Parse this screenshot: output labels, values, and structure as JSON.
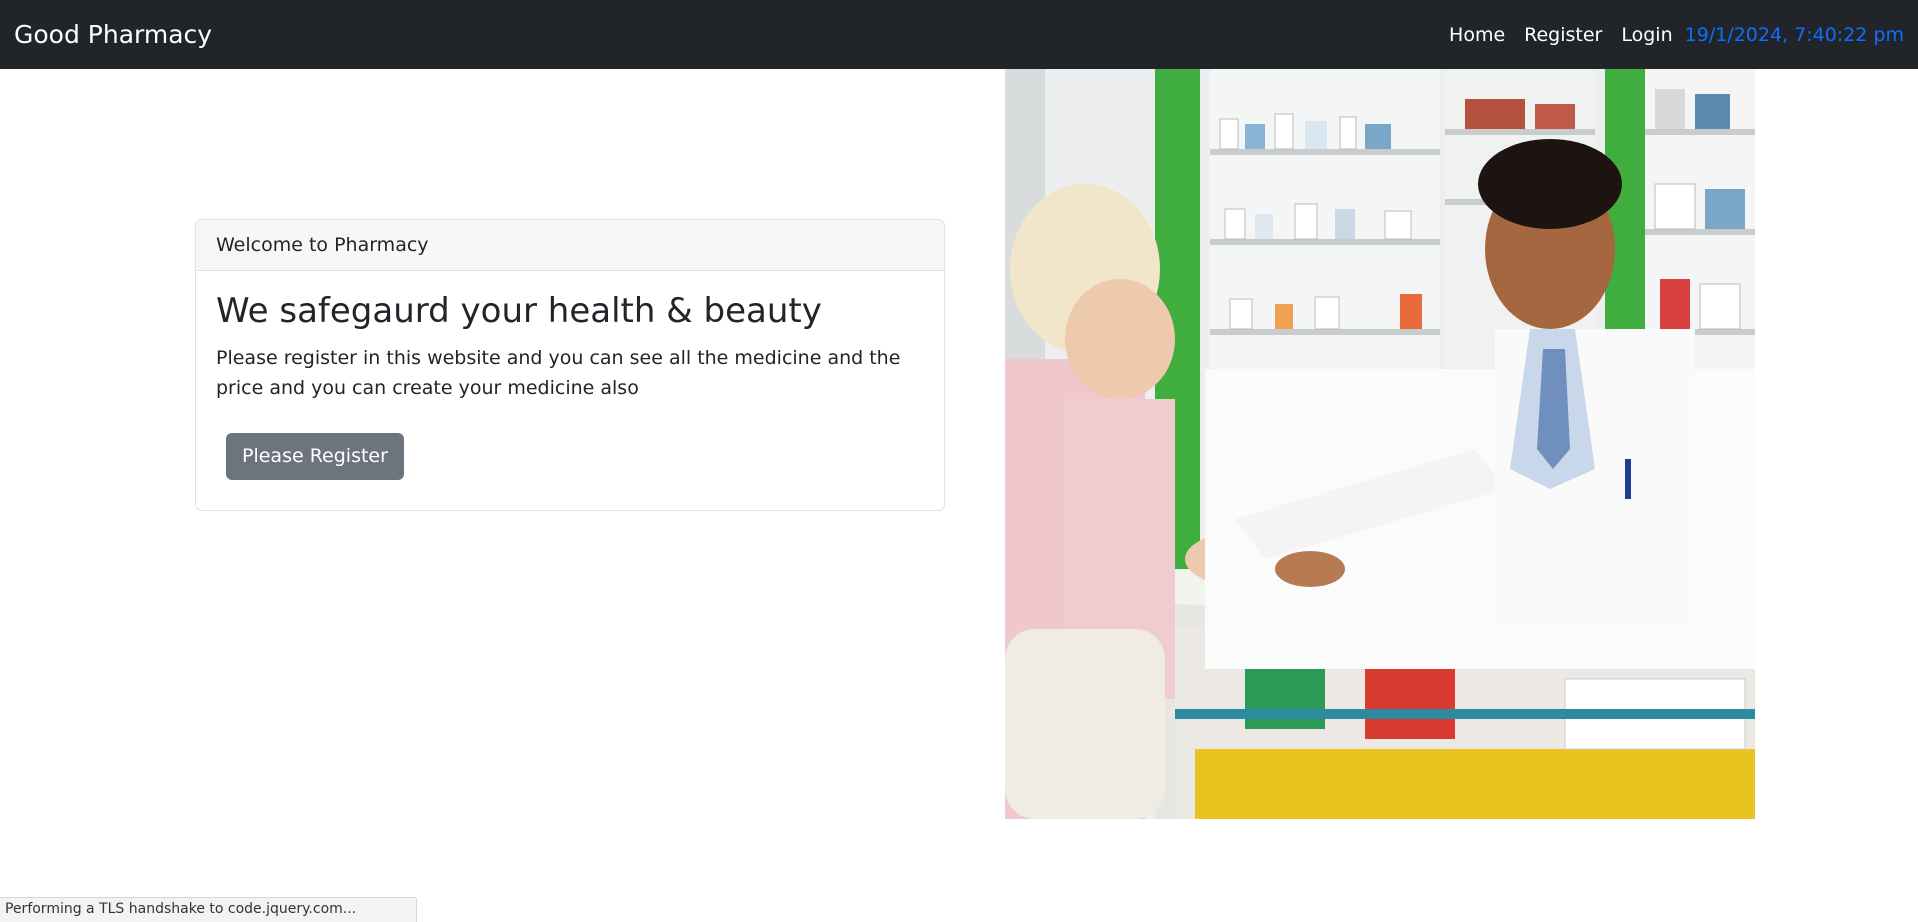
{
  "navbar": {
    "brand": "Good Pharmacy",
    "links": [
      {
        "label": "Home"
      },
      {
        "label": "Register"
      },
      {
        "label": "Login"
      }
    ],
    "datetime": "19/1/2024, 7:40:22 pm",
    "datetime_color": "#0d6efd"
  },
  "card": {
    "header": "Welcome to Pharmacy",
    "title": "We safegaurd your health & beauty",
    "text": "Please register in this website and you can see all the medicine and the price and you can create your medicine also",
    "button_label": "Please Register"
  },
  "hero_image": {
    "icon": "pharmacy-photo"
  },
  "status_bar": {
    "text": "Performing a TLS handshake to code.jquery.com..."
  }
}
